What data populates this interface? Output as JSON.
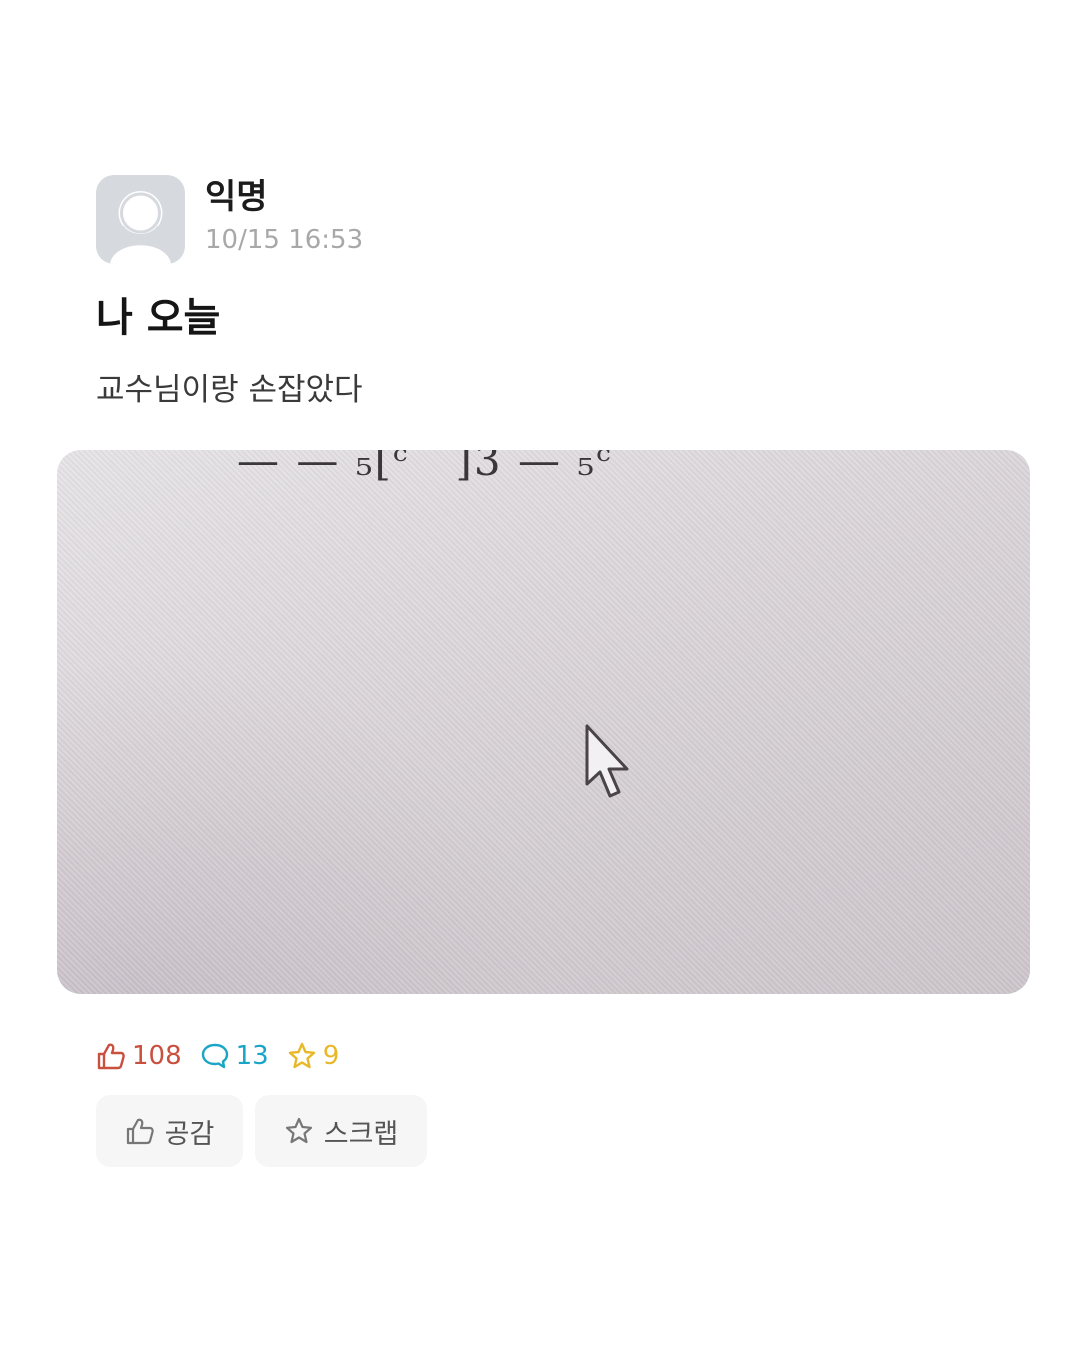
{
  "post": {
    "author": {
      "name": "익명",
      "time": "10/15 16:53",
      "avatar_icon": "default-user-avatar-icon"
    },
    "title": "나 오늘",
    "body": "교수님이랑 손잡았다",
    "image": {
      "formula_text": "— — ₅[ᶜ   ]3 — ₅ᶜ",
      "cursor_icon": "mouse-pointer-icon"
    },
    "stats": {
      "likes": "108",
      "comments": "13",
      "scraps": "9",
      "like_icon": "thumbs-up-icon",
      "comment_icon": "speech-bubble-icon",
      "scrap_icon": "star-icon",
      "like_color": "#c9503f",
      "comment_color": "#1aa5c7",
      "scrap_color": "#e8b828"
    },
    "actions": {
      "empathize_label": "공감",
      "scrap_label": "스크랩"
    }
  }
}
